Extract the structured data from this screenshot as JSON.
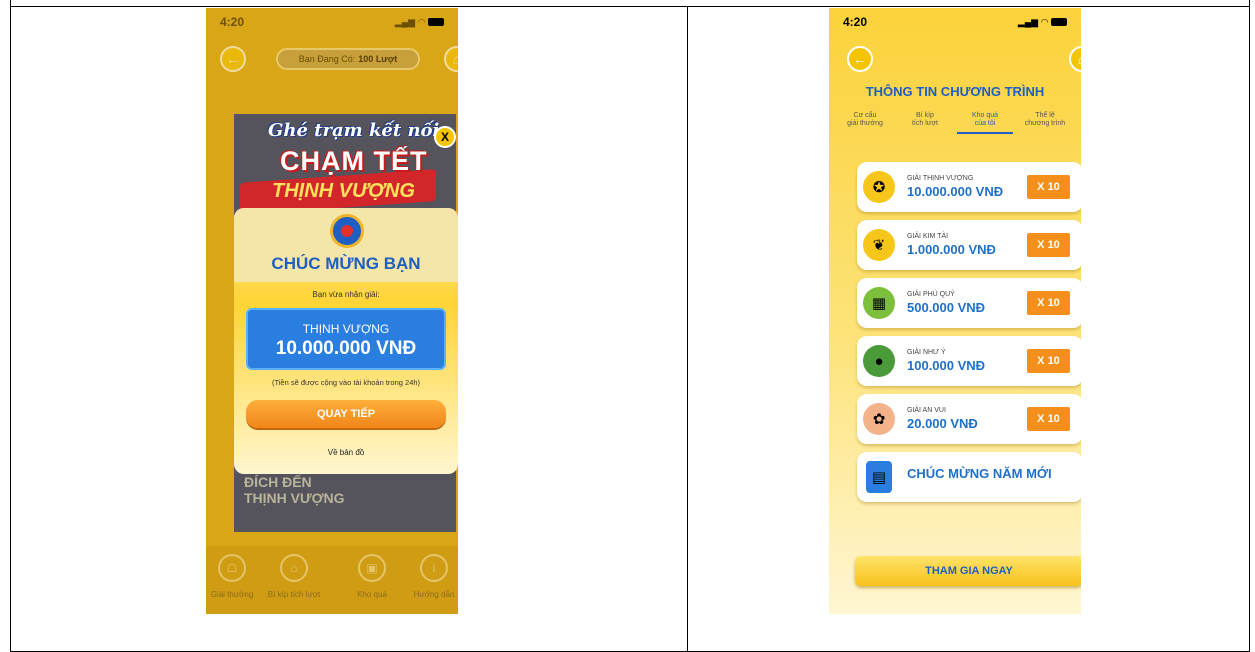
{
  "colors": {
    "primary_blue": "#1f5ec2",
    "accent_orange": "#f38f1a",
    "yellow": "#f7c400"
  },
  "left": {
    "status": {
      "time": "4:20",
      "signal": "▂▄▆",
      "wifi": "◠"
    },
    "header": {
      "back_icon": "arrow-left-icon",
      "balance_prefix": "Bạn Đang Có:",
      "balance_value": "100 Lượt",
      "home_icon": "home-icon"
    },
    "background": {
      "line1": "ĐÍCH ĐẾN",
      "line2": "THỊNH VƯỢNG"
    },
    "banner": {
      "script": "Ghé trạm kết nối",
      "line1": "CHẠM TẾT",
      "line2": "THỊNH VƯỢNG"
    },
    "close": "X",
    "modal": {
      "title": "CHÚC MỪNG BẠN",
      "received": "Bạn vừa nhận giải:",
      "prize_name": "THỊNH VƯỢNG",
      "prize_amount": "10.000.000 VNĐ",
      "note": "(Tiền sẽ được cộng vào tài khoản trong 24h)",
      "spin_again": "QUAY TIẾP",
      "back_to_map": "Về bản đồ"
    },
    "nav": [
      "Giải thưởng",
      "Bí kíp tích lượt",
      "Kho quà",
      "Hướng dẫn"
    ]
  },
  "right": {
    "status": {
      "time": "4:20",
      "signal": "▂▄▆",
      "wifi": "◠"
    },
    "title": "THÔNG TIN CHƯƠNG TRÌNH",
    "tabs": [
      {
        "line1": "Cơ cấu",
        "line2": "giải thưởng"
      },
      {
        "line1": "Bí kíp",
        "line2": "tích lượt"
      },
      {
        "line1": "Kho quà",
        "line2": "của tôi"
      },
      {
        "line1": "Thể lệ",
        "line2": "chương trình"
      }
    ],
    "prizes": [
      {
        "name": "GIẢI THỊNH VƯỢNG",
        "amount": "10.000.000 VNĐ",
        "qty": "X 10",
        "icon": "medal-icon"
      },
      {
        "name": "GIẢI KIM TÀI",
        "amount": "1.000.000 VNĐ",
        "qty": "X 10",
        "icon": "money-tree-icon"
      },
      {
        "name": "GIẢI PHÚ QUÝ",
        "amount": "500.000 VNĐ",
        "qty": "X 10",
        "icon": "banh-chung-icon"
      },
      {
        "name": "GIẢI NHƯ Ý",
        "amount": "100.000 VNĐ",
        "qty": "X 10",
        "icon": "watermelon-icon"
      },
      {
        "name": "GIẢI AN VUI",
        "amount": "20.000 VNĐ",
        "qty": "X 10",
        "icon": "apricot-blossom-icon"
      }
    ],
    "greeting": "CHÚC MỪNG NĂM MỚI",
    "join": "THAM GIA NGAY"
  }
}
